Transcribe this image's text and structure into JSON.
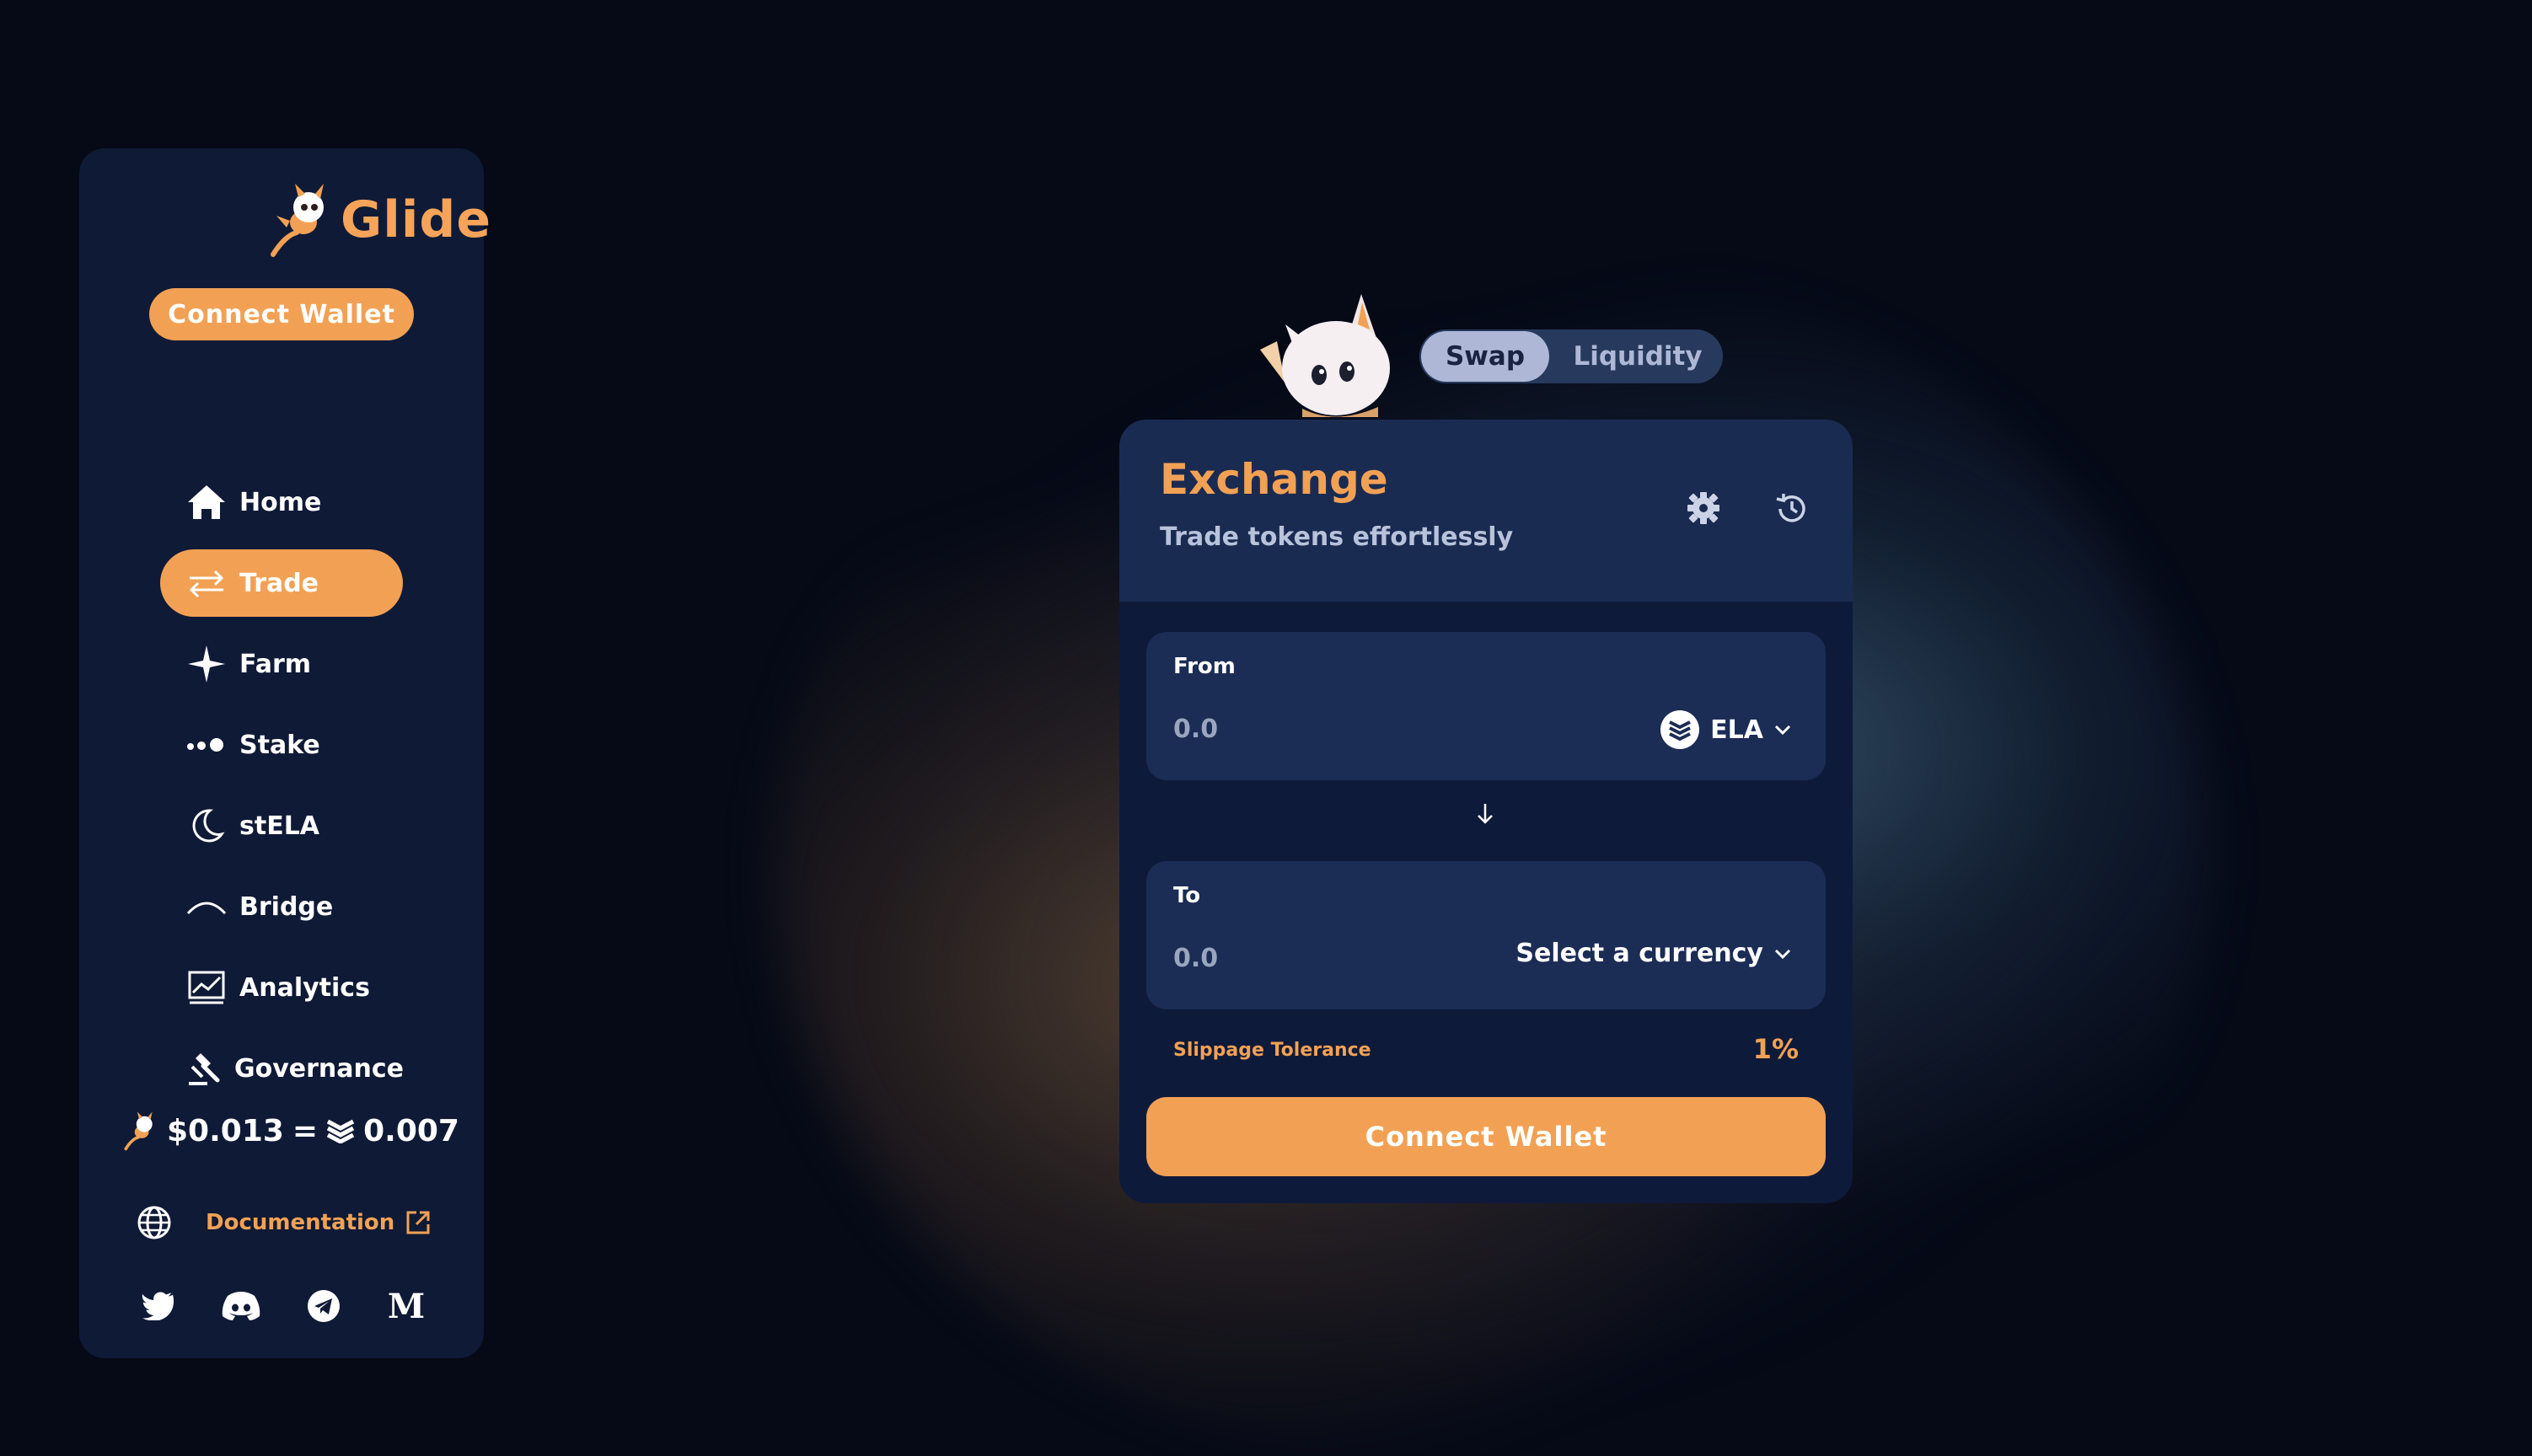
{
  "brand": {
    "name": "Glide"
  },
  "sidebar": {
    "connect_label": "Connect Wallet",
    "nav": [
      {
        "label": "Home",
        "icon": "home-icon"
      },
      {
        "label": "Trade",
        "icon": "swap-arrows-icon",
        "active": true
      },
      {
        "label": "Farm",
        "icon": "sparkle-icon"
      },
      {
        "label": "Stake",
        "icon": "dots-icon"
      },
      {
        "label": "stELA",
        "icon": "moon-icon"
      },
      {
        "label": "Bridge",
        "icon": "arc-icon"
      },
      {
        "label": "Analytics",
        "icon": "chart-icon"
      },
      {
        "label": "Governance",
        "icon": "gavel-icon"
      }
    ],
    "price": {
      "usd": "$0.013",
      "equals": "=",
      "ela": "0.007"
    },
    "docs_label": "Documentation",
    "socials": [
      "twitter-icon",
      "discord-icon",
      "telegram-icon",
      "medium-icon"
    ]
  },
  "tabs": {
    "swap": "Swap",
    "liquidity": "Liquidity"
  },
  "exchange": {
    "title": "Exchange",
    "subtitle": "Trade tokens effortlessly",
    "from": {
      "label": "From",
      "amount": "0.0",
      "token": "ELA"
    },
    "to": {
      "label": "To",
      "amount": "0.0",
      "token": "Select a currency"
    },
    "slippage_label": "Slippage Tolerance",
    "slippage_value": "1%",
    "connect_label": "Connect Wallet"
  },
  "colors": {
    "accent": "#f2a154",
    "card": "#0e1a3a",
    "panel": "#1b2c55",
    "background": "#060a17"
  }
}
